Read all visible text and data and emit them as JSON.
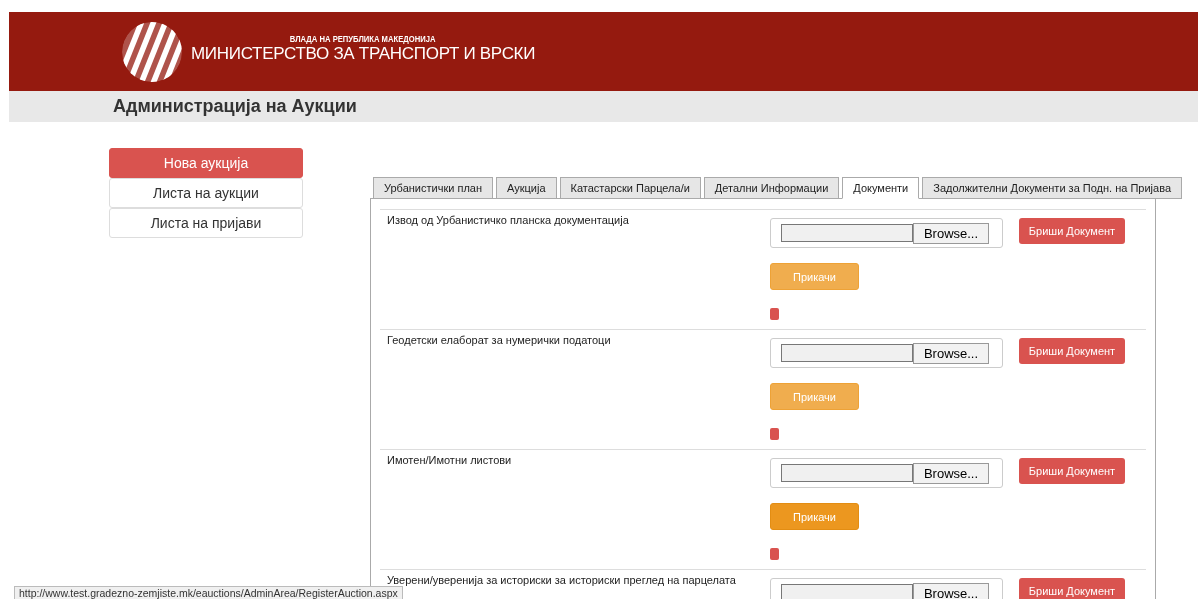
{
  "header": {
    "subtitle": "ВЛАДА НА РЕПУБЛИКА МАКЕДОНИЈА",
    "title": "МИНИСТЕРСТВО ЗА ТРАНСПОРТ И ВРСКИ"
  },
  "page_title": "Администрација на Аукции",
  "sidebar": {
    "items": [
      {
        "label": "Нова аукција",
        "selected": true
      },
      {
        "label": "Листа на аукции",
        "selected": false
      },
      {
        "label": "Листа на пријави",
        "selected": false
      }
    ]
  },
  "tabs": [
    {
      "label": "Урбанистички план",
      "selected": false
    },
    {
      "label": "Аукција",
      "selected": false
    },
    {
      "label": "Катастарски Парцела/и",
      "selected": false
    },
    {
      "label": "Детални Информации",
      "selected": false
    },
    {
      "label": "Документи",
      "selected": true
    },
    {
      "label": "Задолжителни Документи за Подн. на Пријава",
      "selected": false
    }
  ],
  "documents": [
    {
      "label": "Извод од Урбанистичко планска документација",
      "browse": "Browse...",
      "delete": "Бриши Документ",
      "attach": "Прикачи",
      "attach_highlighted": false
    },
    {
      "label": "Геодетски елаборат за нумерички податоци",
      "browse": "Browse...",
      "delete": "Бриши Документ",
      "attach": "Прикачи",
      "attach_highlighted": false
    },
    {
      "label": "Имотен/Имотни листови",
      "browse": "Browse...",
      "delete": "Бриши Документ",
      "attach": "Прикачи",
      "attach_highlighted": true
    },
    {
      "label": "Уверени/уверенија за историски за историски преглед на парцелата",
      "browse": "Browse...",
      "delete": "Бриши Документ"
    }
  ],
  "status_bar": {
    "url": "http://www.test.gradezno-zemjiste.mk/eauctions/AdminArea/RegisterAuction.aspx"
  }
}
